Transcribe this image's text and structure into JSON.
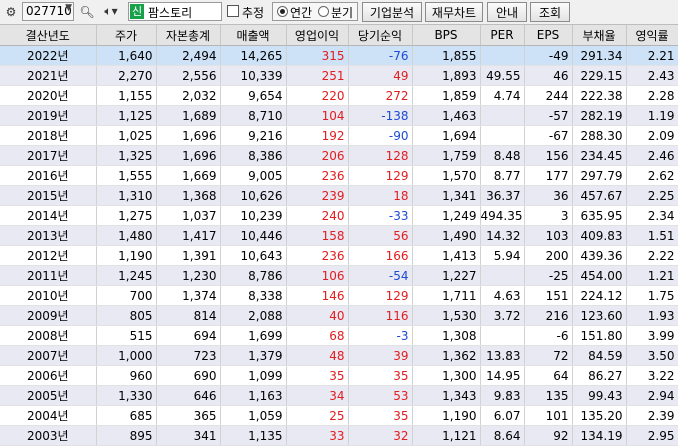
{
  "toolbar": {
    "code": "027710",
    "company_badge": "신",
    "company": "팜스토리",
    "estimate_label": "추정",
    "annual_label": "연간",
    "quarter_label": "분기",
    "buttons": [
      "기업분석",
      "재무차트",
      "안내",
      "조회"
    ]
  },
  "table": {
    "headers": [
      "결산년도",
      "주가",
      "자본총계",
      "매출액",
      "영업이익",
      "당기순익",
      "BPS",
      "PER",
      "EPS",
      "부채율",
      "영익률"
    ],
    "rows": [
      [
        "2022년",
        "1,640",
        "2,494",
        "14,265",
        "315",
        "-76",
        "1,855",
        "",
        "-49",
        "291.34",
        "2.21"
      ],
      [
        "2021년",
        "2,270",
        "2,556",
        "10,339",
        "251",
        "49",
        "1,893",
        "49.55",
        "46",
        "229.15",
        "2.43"
      ],
      [
        "2020년",
        "1,155",
        "2,032",
        "9,654",
        "220",
        "272",
        "1,859",
        "4.74",
        "244",
        "222.38",
        "2.28"
      ],
      [
        "2019년",
        "1,125",
        "1,689",
        "8,710",
        "104",
        "-138",
        "1,463",
        "",
        "-57",
        "282.19",
        "1.19"
      ],
      [
        "2018년",
        "1,025",
        "1,696",
        "9,216",
        "192",
        "-90",
        "1,694",
        "",
        "-67",
        "288.30",
        "2.09"
      ],
      [
        "2017년",
        "1,325",
        "1,696",
        "8,386",
        "206",
        "128",
        "1,759",
        "8.48",
        "156",
        "234.45",
        "2.46"
      ],
      [
        "2016년",
        "1,555",
        "1,669",
        "9,005",
        "236",
        "129",
        "1,570",
        "8.77",
        "177",
        "297.79",
        "2.62"
      ],
      [
        "2015년",
        "1,310",
        "1,368",
        "10,626",
        "239",
        "18",
        "1,341",
        "36.37",
        "36",
        "457.67",
        "2.25"
      ],
      [
        "2014년",
        "1,275",
        "1,037",
        "10,239",
        "240",
        "-33",
        "1,249",
        "494.35",
        "3",
        "635.95",
        "2.34"
      ],
      [
        "2013년",
        "1,480",
        "1,417",
        "10,446",
        "158",
        "56",
        "1,490",
        "14.32",
        "103",
        "409.83",
        "1.51"
      ],
      [
        "2012년",
        "1,190",
        "1,391",
        "10,643",
        "236",
        "166",
        "1,413",
        "5.94",
        "200",
        "439.36",
        "2.22"
      ],
      [
        "2011년",
        "1,245",
        "1,230",
        "8,786",
        "106",
        "-54",
        "1,227",
        "",
        "-25",
        "454.00",
        "1.21"
      ],
      [
        "2010년",
        "700",
        "1,374",
        "8,338",
        "146",
        "129",
        "1,711",
        "4.63",
        "151",
        "224.12",
        "1.75"
      ],
      [
        "2009년",
        "805",
        "814",
        "2,088",
        "40",
        "116",
        "1,530",
        "3.72",
        "216",
        "123.60",
        "1.93"
      ],
      [
        "2008년",
        "515",
        "694",
        "1,699",
        "68",
        "-3",
        "1,308",
        "",
        "-6",
        "151.80",
        "3.99"
      ],
      [
        "2007년",
        "1,000",
        "723",
        "1,379",
        "48",
        "39",
        "1,362",
        "13.83",
        "72",
        "84.59",
        "3.50"
      ],
      [
        "2006년",
        "960",
        "690",
        "1,099",
        "35",
        "35",
        "1,300",
        "14.95",
        "64",
        "86.27",
        "3.22"
      ],
      [
        "2005년",
        "1,330",
        "646",
        "1,163",
        "34",
        "53",
        "1,343",
        "9.83",
        "135",
        "99.43",
        "2.94"
      ],
      [
        "2004년",
        "685",
        "365",
        "1,059",
        "25",
        "35",
        "1,190",
        "6.07",
        "101",
        "135.20",
        "2.39"
      ],
      [
        "2003년",
        "895",
        "341",
        "1,135",
        "33",
        "32",
        "1,121",
        "8.64",
        "92",
        "134.19",
        "2.95"
      ]
    ]
  },
  "colors": {
    "positive": "#e21d1d",
    "negative": "#1b4bd4",
    "selected_row": "#cde2f7",
    "alt_row": "#e9e9f4"
  }
}
